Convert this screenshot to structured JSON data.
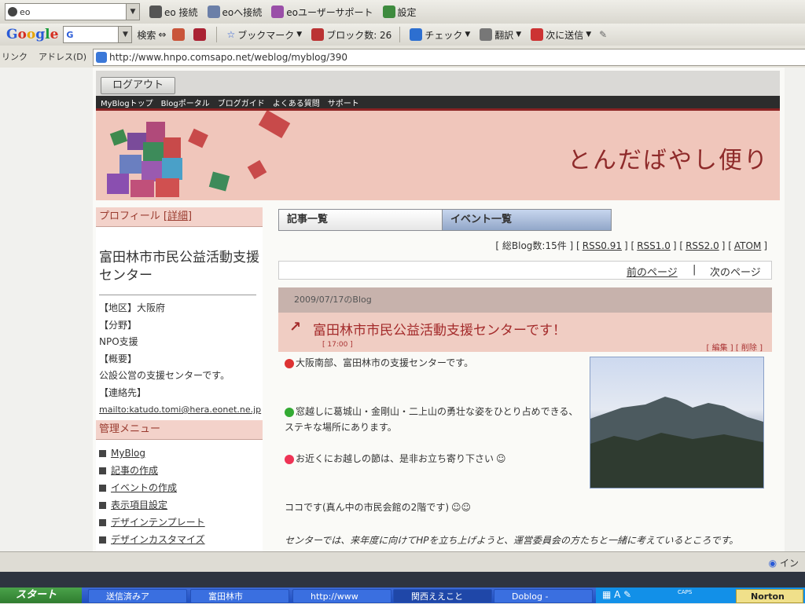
{
  "browser": {
    "eo_combo": "eo",
    "toolbar1": [
      {
        "label": "eo 接続",
        "icon": "eo-connect-icon"
      },
      {
        "label": "eoへ接続",
        "icon": "eo-home-icon"
      },
      {
        "label": "eoユーザーサポート",
        "icon": "support-icon"
      },
      {
        "label": "設定",
        "icon": "settings-icon"
      }
    ],
    "google": {
      "logo": "Google",
      "search_value": "G",
      "search_label": "検索"
    },
    "toolbar2": [
      {
        "label": "ブックマーク",
        "icon": "star-icon"
      },
      {
        "label": "ブロック数: 26",
        "icon": "popup-block-icon"
      },
      {
        "label": "チェック",
        "icon": "spellcheck-icon"
      },
      {
        "label": "翻訳",
        "icon": "translate-icon"
      },
      {
        "label": "次に送信",
        "icon": "send-icon"
      }
    ],
    "links_label": "リンク",
    "address_label": "アドレス(D)",
    "url": "http://www.hnpo.comsapo.net/weblog/myblog/390",
    "status_right": "イン"
  },
  "page": {
    "logout": "ログアウト",
    "nav": [
      "MyBlogトップ",
      "Blogポータル",
      "ブログガイド",
      "よくある質問",
      "サポート"
    ],
    "blog_title": "とんだばやし便り",
    "profile": {
      "heading": "プロフィール",
      "detail_link": "[詳細]",
      "org_name": "富田林市市民公益活動支援センター",
      "entries": [
        "【地区】大阪府",
        "【分野】",
        "NPO支援",
        "【概要】",
        "公設公営の支援センターです。",
        "【連絡先】"
      ],
      "email": "mailto:katudo.tomi@hera.eonet.ne.jp"
    },
    "admin_menu": {
      "heading": "管理メニュー",
      "items": [
        "MyBlog",
        "記事の作成",
        "イベントの作成",
        "表示項目設定",
        "デザインテンプレート",
        "デザインカスタマイズ"
      ]
    },
    "tabs": [
      "記事一覧",
      "イベント一覧"
    ],
    "stats": {
      "count": "[ 総Blog数:15件 ]",
      "links": [
        "RSS0.91",
        "RSS1.0",
        "RSS2.0",
        "ATOM"
      ]
    },
    "pager": {
      "prev": "前のページ",
      "sep": "|",
      "next": "次のページ"
    },
    "post": {
      "date": "2009/07/17のBlog",
      "title": "富田林市市民公益活動支援センターです！",
      "time": "[ 17:00 ]",
      "actions": "[ 編集 ] [ 削除 ]",
      "lines": [
        "大阪南部、富田林市の支援センターです。",
        "窓越しに葛城山・金剛山・二上山の勇壮な姿をひとり占めできる、ステキな場所にあります。",
        "お近くにお越しの節は、是非お立ち寄り下さい",
        "ココです(真ん中の市民会館の2階です)",
        "センターでは、来年度に向けてHPを立ち上げようと、運営委員会の方たちと一緒に考えているところです。"
      ]
    }
  },
  "taskbar": {
    "start": "スタート",
    "tasks": [
      "送信済みア",
      "富田林市",
      "http://www",
      "関西ええこと",
      "Doblog -"
    ],
    "caps": "CAPS",
    "norton": "Norton"
  },
  "colors": {
    "accent": "#8e2a2a",
    "banner": "#f0c6bb",
    "nav": "#2c2c2c",
    "taskbar": "#2a5bd0"
  }
}
